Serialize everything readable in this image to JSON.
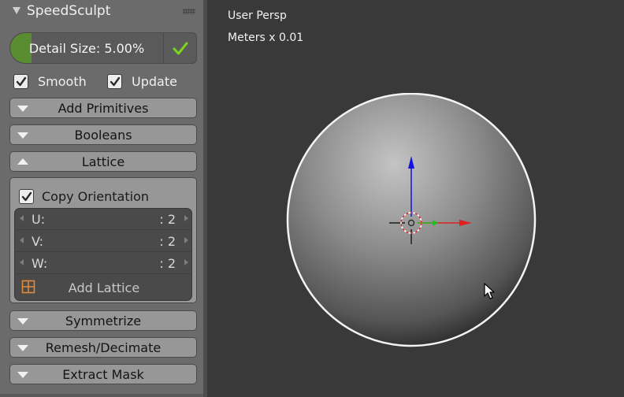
{
  "panel": {
    "title": "SpeedSculpt",
    "detail_size": {
      "label": "Detail Size: 5.00%",
      "value": 5.0,
      "fill_fraction": 0.14
    },
    "checkboxes": [
      {
        "label": "Smooth",
        "checked": true
      },
      {
        "label": "Update",
        "checked": true
      }
    ],
    "sections_top": [
      {
        "label": "Add Primitives",
        "expanded": false
      },
      {
        "label": "Booleans",
        "expanded": false
      },
      {
        "label": "Lattice",
        "expanded": true
      }
    ],
    "lattice": {
      "copy_orientation": {
        "label": "Copy Orientation",
        "checked": true
      },
      "fields": [
        {
          "label": "U:",
          "value": ": 2"
        },
        {
          "label": "V:",
          "value": ": 2"
        },
        {
          "label": "W:",
          "value": ": 2"
        }
      ],
      "add_button": "Add Lattice"
    },
    "sections_bottom": [
      {
        "label": "Symmetrize",
        "expanded": false
      },
      {
        "label": "Remesh/Decimate",
        "expanded": false
      },
      {
        "label": "Extract Mask",
        "expanded": false
      }
    ]
  },
  "viewport": {
    "view_name": "User Persp",
    "units": "Meters x 0.01"
  },
  "colors": {
    "panel_bg": "#6b6b6b",
    "viewport_bg": "#393939",
    "slider_fill": "#5a8c31",
    "check_green": "#7ed321",
    "axis_x": "#e02020",
    "axis_y": "#20c020",
    "axis_z": "#1010e0",
    "lattice_icon": "#e08a3c"
  },
  "icons": [
    "check-icon",
    "grip-icon",
    "lattice-grid-icon",
    "mouse-cursor-icon",
    "transform-gizmo-icon"
  ]
}
